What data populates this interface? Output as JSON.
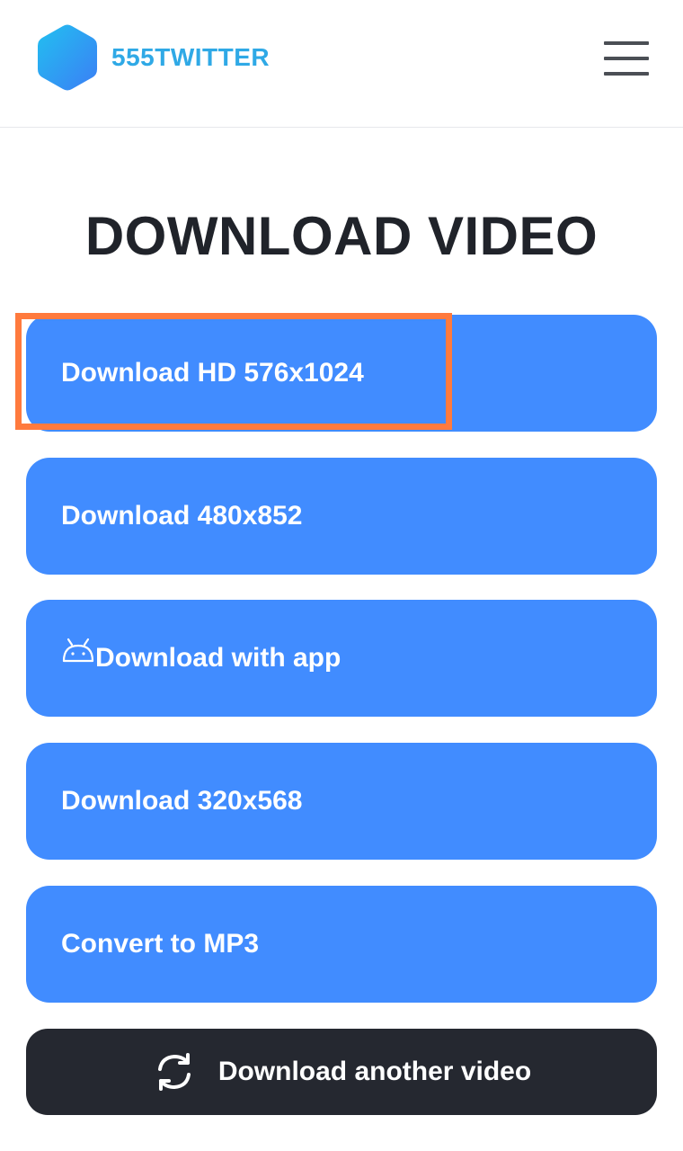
{
  "header": {
    "logo_text": "555TWITTER",
    "brand_color": "#2fa9e6"
  },
  "main": {
    "title": "DOWNLOAD VIDEO",
    "buttons": [
      {
        "label": "Download HD 576x1024",
        "icon": null,
        "highlighted": true
      },
      {
        "label": "Download 480x852",
        "icon": null
      },
      {
        "label": "Download with app",
        "icon": "android-icon"
      },
      {
        "label": "Download 320x568",
        "icon": null
      },
      {
        "label": "Convert to MP3",
        "icon": null
      }
    ],
    "another": {
      "label": "Download another video",
      "icon": "refresh-icon"
    }
  },
  "colors": {
    "button_blue": "#418cff",
    "dark_button": "#252830",
    "highlight": "#ff7a3d"
  }
}
